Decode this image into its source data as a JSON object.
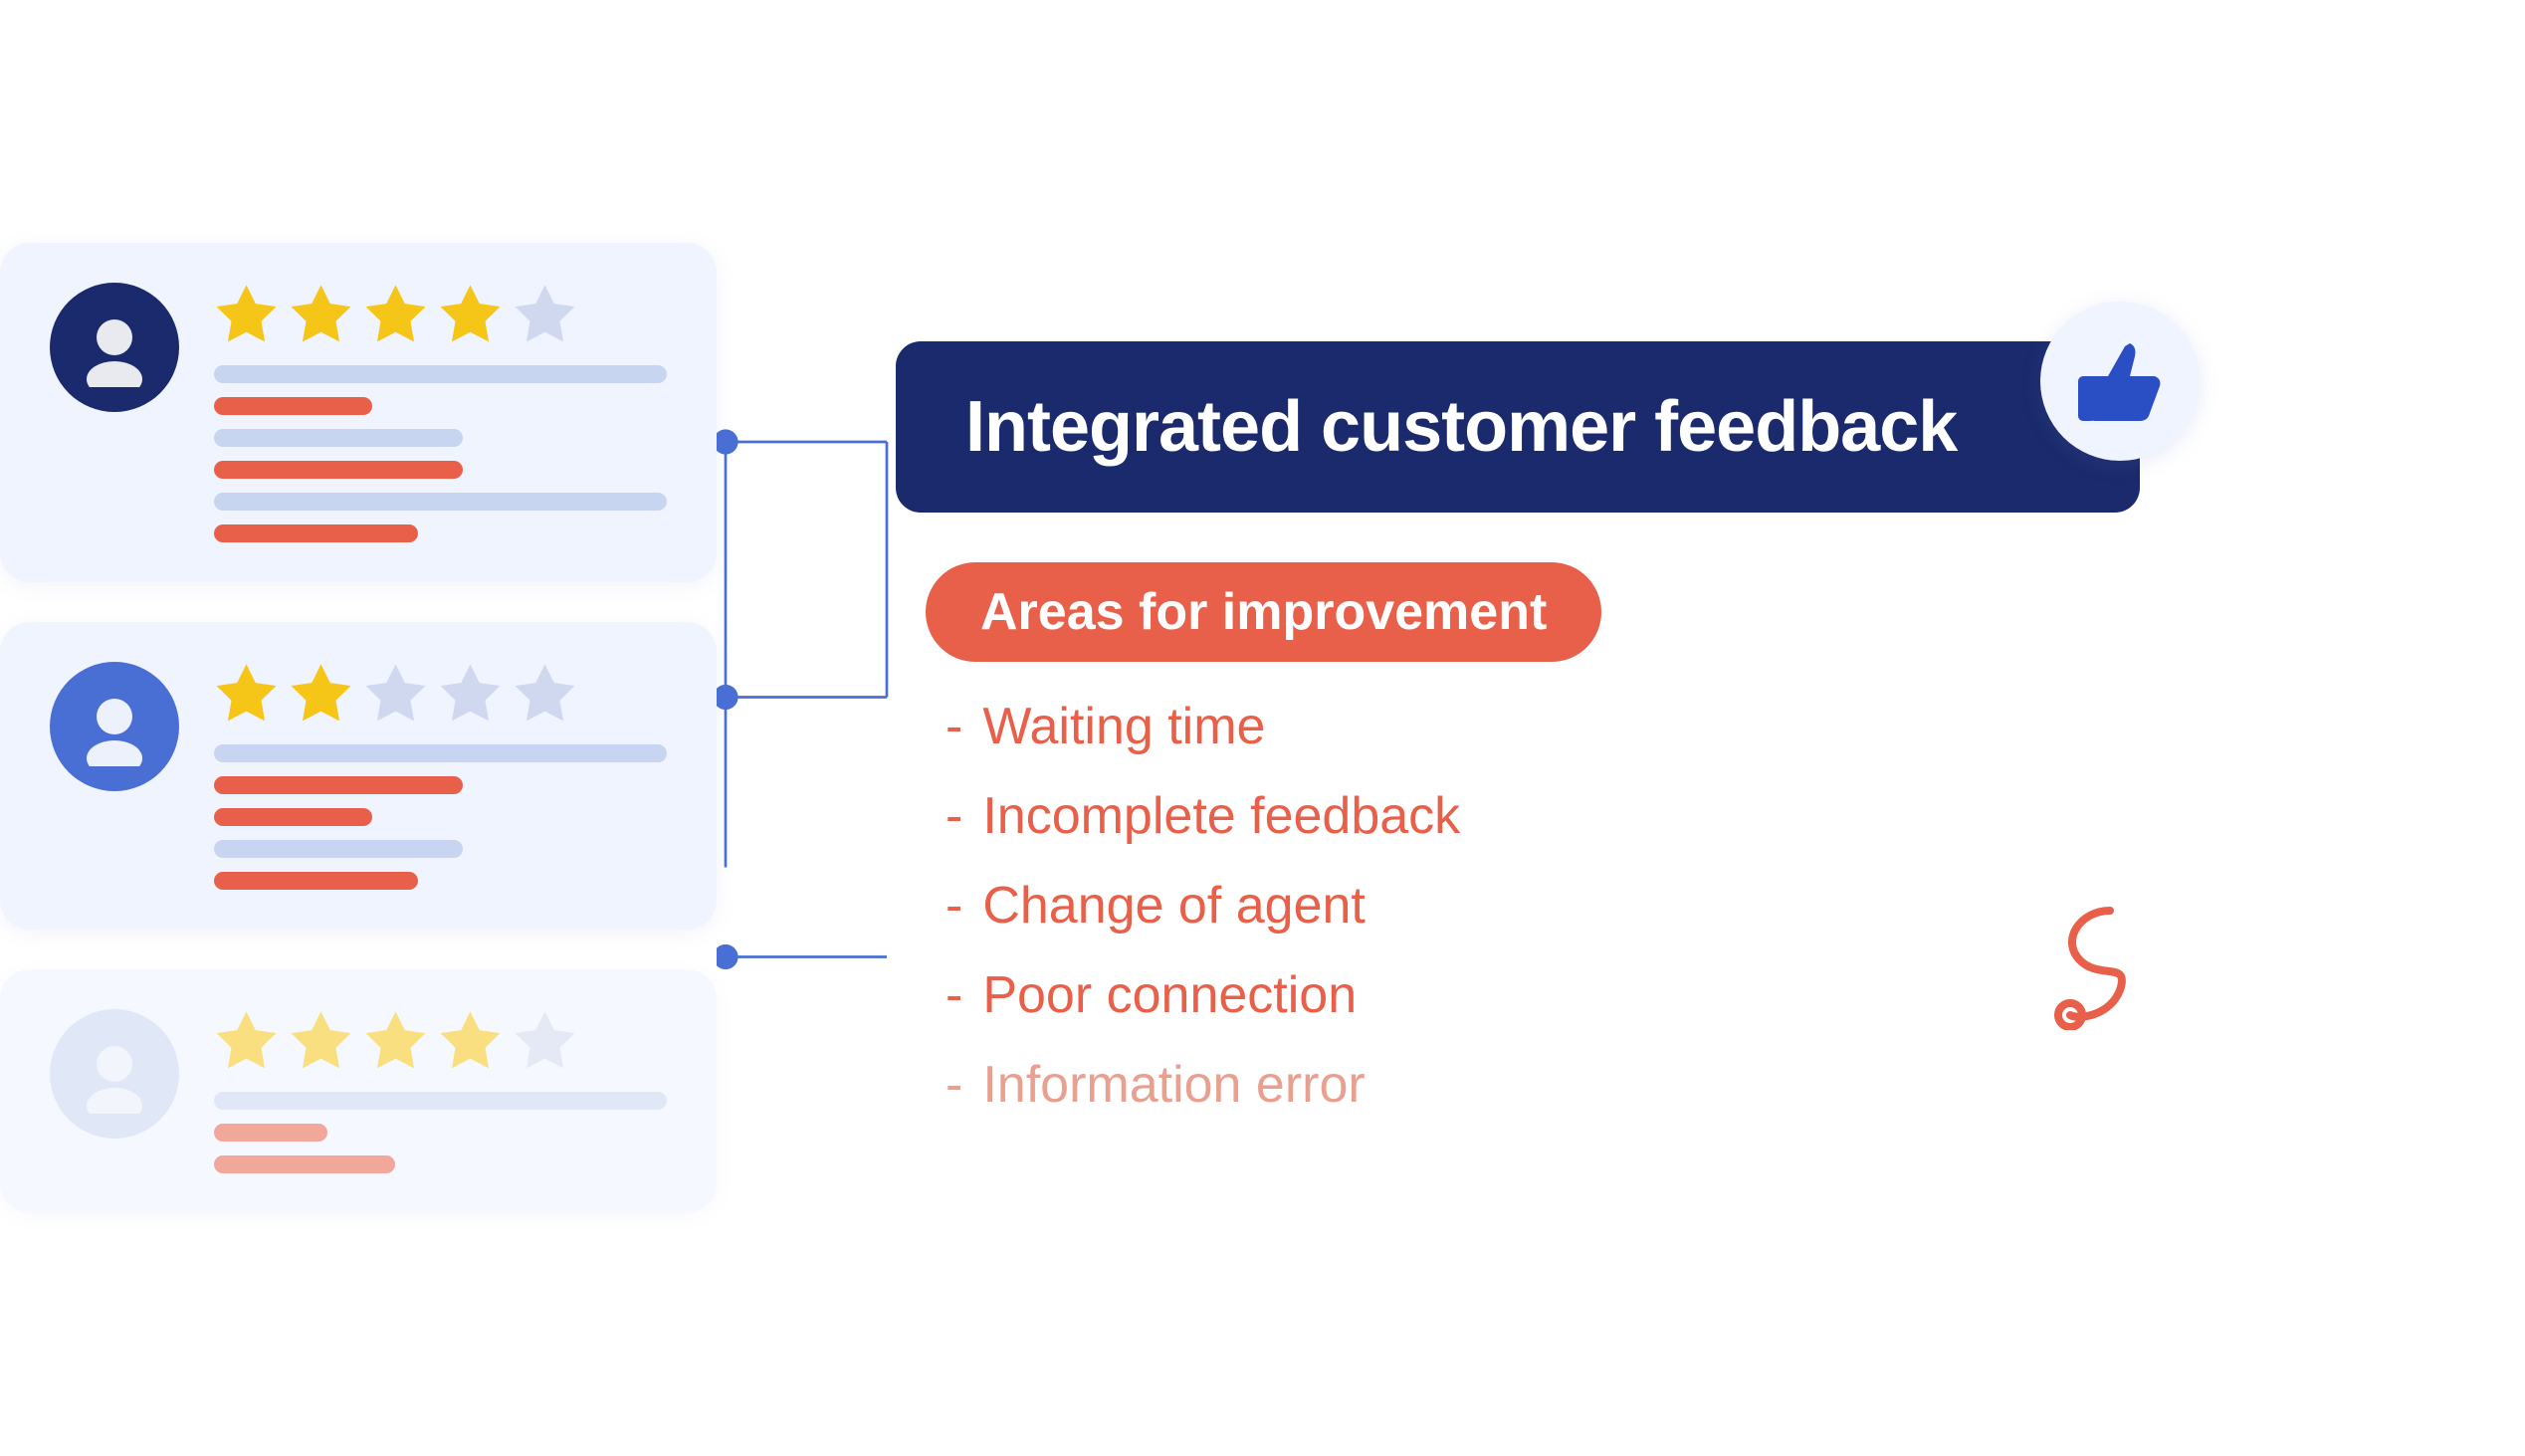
{
  "header": {
    "title": "Integrated customer feedback"
  },
  "improvement_badge": {
    "label": "Areas for improvement"
  },
  "improvement_items": [
    {
      "id": "waiting-time",
      "text": "Waiting time",
      "dash": "-",
      "opacity": "full"
    },
    {
      "id": "incomplete-feedback",
      "text": "Incomplete feedback",
      "dash": "-",
      "opacity": "full"
    },
    {
      "id": "change-of-agent",
      "text": "Change of agent",
      "dash": "-",
      "opacity": "full"
    },
    {
      "id": "poor-connection",
      "text": "Poor connection",
      "dash": "-",
      "opacity": "full"
    },
    {
      "id": "information-error",
      "text": "Information error",
      "dash": "-",
      "opacity": "light"
    }
  ],
  "cards": [
    {
      "id": "card-1",
      "stars_filled": 4,
      "stars_empty": 1,
      "avatar_color": "#1a2a6c"
    },
    {
      "id": "card-2",
      "stars_filled": 2,
      "stars_empty": 3,
      "avatar_color": "#4a6fd4"
    },
    {
      "id": "card-3",
      "stars_filled": 4,
      "stars_empty": 1,
      "avatar_color": "#c8d5f0"
    }
  ],
  "icons": {
    "thumbs_up": "👍",
    "squiggle": "decorative"
  }
}
